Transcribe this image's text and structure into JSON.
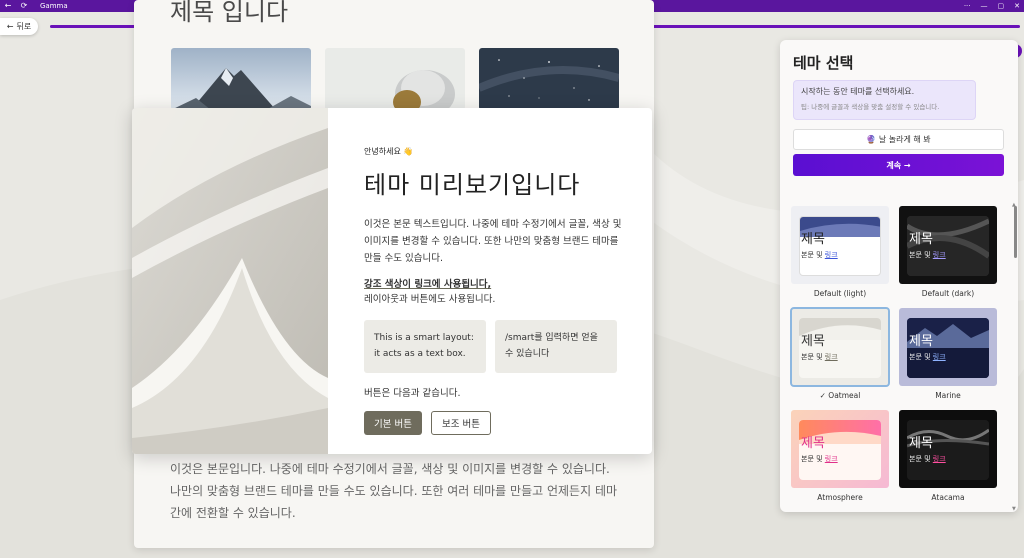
{
  "window": {
    "app_title": "Gamma"
  },
  "nav": {
    "back_label": "뒤로"
  },
  "progress": {
    "fraction": 1.0
  },
  "document": {
    "heading": "제목 입니다",
    "body": "이것은 본문입니다. 나중에 테마 수정기에서 글꼴, 색상 및 이미지를 변경할 수 있습니다. 나만의 맞춤형 브랜드 테마를 만들 수도 있습니다. 또한 여러 테마를 만들고 언제든지 테마 간에 전환할 수 있습니다."
  },
  "preview": {
    "greeting": "안녕하세요 👋",
    "title": "테마 미리보기입니다",
    "paragraph": "이것은 본문 텍스트입니다. 나중에 테마 수정기에서 글꼴, 색상 및 이미지를 변경할 수 있습니다. 또한 나만의 맞춤형 브랜드 테마를 만들 수도 있습니다.",
    "accent_link": "강조 색상이 링크에 사용됩니다,",
    "accent_sub": "레이아웃과 버튼에도 사용됩니다.",
    "smart_box_1": "This is a smart layout: it acts as a text box.",
    "smart_box_2": "/smart를 입력하면 얻을 수 있습니다",
    "buttons_label": "버튼은 다음과 같습니다.",
    "primary_button": "기본 버튼",
    "secondary_button": "보조 버튼"
  },
  "theme_panel": {
    "title": "테마 선택",
    "info_main": "시작하는 동안 테마를 선택하세요.",
    "info_tip": "팁: 나중에 글꼴과 색상을 맞춤 설정할 수 있습니다.",
    "surprise_label": "🔮 날 놀라게 해 봐",
    "continue_label": "계속 →",
    "card_title": "제목",
    "card_body": "본문 및",
    "card_link": "링크",
    "selected_theme": "Oatmeal",
    "themes": [
      {
        "name": "Default (light)"
      },
      {
        "name": "Default (dark)"
      },
      {
        "name": "✓ Oatmeal"
      },
      {
        "name": "Marine"
      },
      {
        "name": "Atmosphere"
      },
      {
        "name": "Atacama"
      }
    ]
  },
  "colors": {
    "titlebar": "#5a169e",
    "accent": "#6a11b8",
    "oatmeal_button": "#6f6c5d"
  },
  "icons": {
    "back": "arrow-left-icon",
    "refresh": "refresh-icon",
    "check": "check-icon"
  }
}
